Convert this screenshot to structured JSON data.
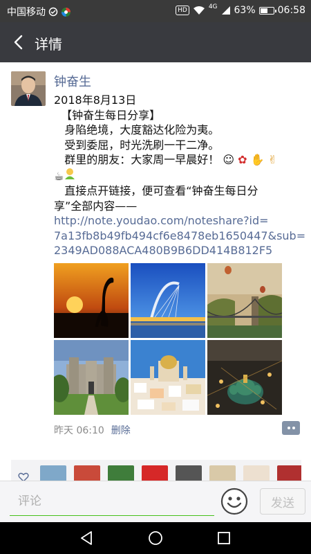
{
  "status_bar": {
    "carrier": "中国移动",
    "net_type": "4G",
    "battery_level": "63%",
    "battery_fraction": 0.63,
    "time": "06:58",
    "hd_label": "HD"
  },
  "nav": {
    "back_icon": "chevron-left-icon",
    "title": "详情"
  },
  "post": {
    "author": "钟奋生",
    "date": "2018年8月13日",
    "lines": [
      "【钟奋生每日分享】",
      "身陷绝境，大度豁达化险为夷。",
      "受到委屈，时光洗刷一干二净。",
      "群里的朋友：大家周一早晨好！"
    ],
    "emoji_icons": [
      "smile-emoji",
      "rose-emoji",
      "handshake-emoji",
      "pray-emoji",
      "coffee-emoji",
      "hug-emoji"
    ],
    "link_intro_1": "直接点开链接，便可查看“钟奋生每日分",
    "link_intro_2": "享”全部内容——",
    "link_lines": [
      "http://note.youdao.com/noteshare?id=",
      "7a13fb8b49fb494cf6e8478eb1650447&sub=",
      "2349AD088ACA480B9B6DD414B812F5"
    ],
    "images": [
      "sunset-crane-image",
      "harp-bridge-image",
      "suspension-bridge-image",
      "castle-image",
      "coastal-city-image",
      "cathedral-night-image"
    ],
    "time_ago": "昨天 06:10",
    "delete_label": "删除",
    "comment_icon": "comment-bubble-icon"
  },
  "likes": {
    "heart_icon": "heart-outline-icon",
    "avatar_colors": [
      "#7fa8c9",
      "#c94a3a",
      "#3f7d3b",
      "#d62828",
      "#555555",
      "#d9c9a8",
      "#ede0d0",
      "#b03030"
    ]
  },
  "input_bar": {
    "placeholder": "评论",
    "emoji_button_icon": "smiley-icon",
    "send_label": "发送"
  },
  "system_nav": {
    "back": "triangle-back-icon",
    "home": "circle-home-icon",
    "recent": "square-recent-icon"
  }
}
